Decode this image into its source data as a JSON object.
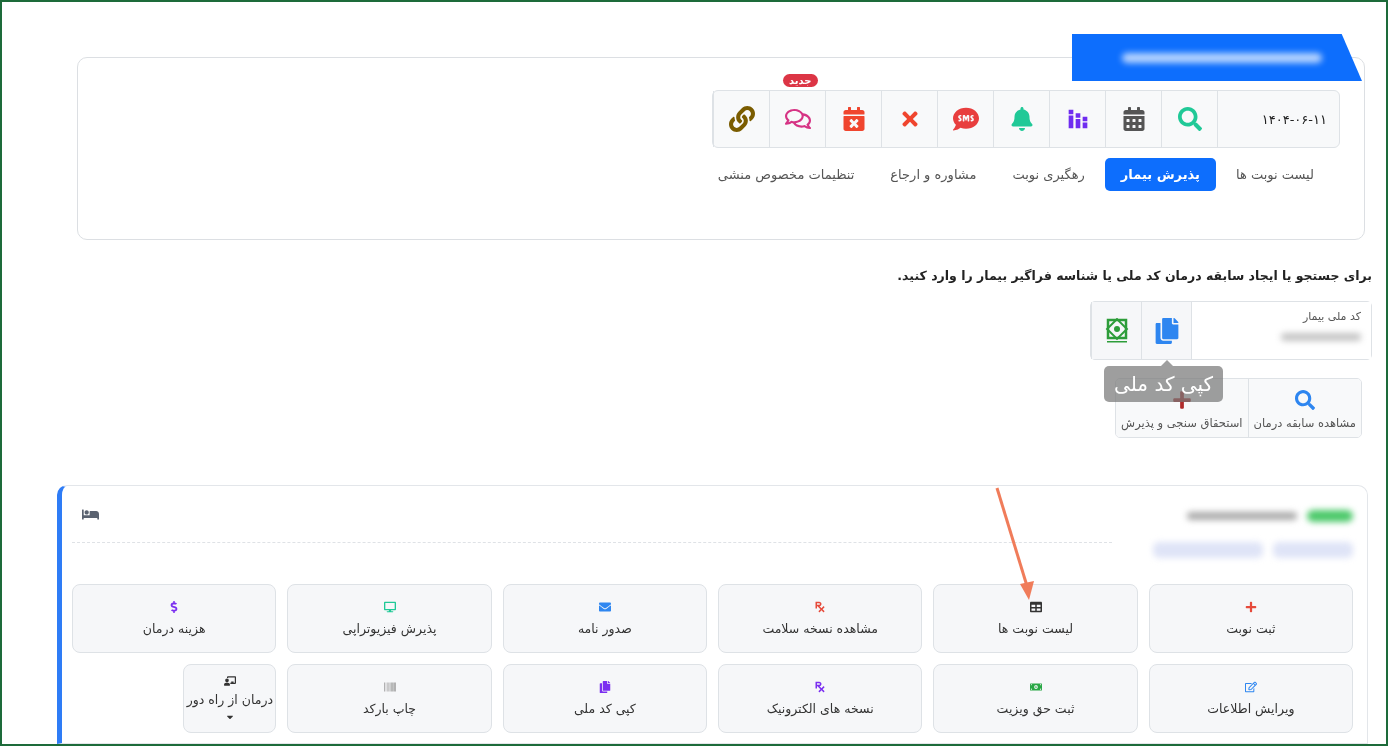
{
  "toolbar": {
    "date": "۱۴۰۴-۰۶-۱۱",
    "badge": "جدید",
    "buttons": [
      {
        "kind": "search"
      },
      {
        "kind": "calendar"
      },
      {
        "kind": "chart"
      },
      {
        "kind": "bell"
      },
      {
        "kind": "sms"
      },
      {
        "kind": "cancel"
      },
      {
        "kind": "calendar-cancel"
      },
      {
        "kind": "chat"
      },
      {
        "kind": "link"
      }
    ]
  },
  "tabs": [
    {
      "label": "لیست نوبت ها",
      "selected": false
    },
    {
      "label": "پذیرش بیمار",
      "selected": true
    },
    {
      "label": "رهگیری نوبت",
      "selected": false
    },
    {
      "label": "مشاوره و ارجاع",
      "selected": false
    },
    {
      "label": "تنظیمات مخصوص منشی",
      "selected": false
    }
  ],
  "instruction": "برای جستجو یا ایجاد سابقه درمان کد ملی یا شناسه فراگیر بیمار را وارد کنید.",
  "patient_field": {
    "label": "کد ملی بیمار"
  },
  "tooltip": "کپی کد ملی",
  "actions": [
    {
      "kind": "search",
      "label": "مشاهده سابقه درمان"
    },
    {
      "kind": "plus",
      "label": "استحقاق سنجی و پذیرش"
    }
  ],
  "services": [
    {
      "kind": "plus",
      "label": "ثبت نوبت"
    },
    {
      "kind": "table",
      "label": "لیست نوبت ها"
    },
    {
      "kind": "rx",
      "label": "مشاهده نسخه سلامت"
    },
    {
      "kind": "mail",
      "label": "صدور نامه"
    },
    {
      "kind": "monitor",
      "label": "پذیرش فیزیوتراپی"
    },
    {
      "kind": "dollar",
      "label": "هزینه درمان"
    },
    {
      "kind": "edit",
      "label": "ویرایش اطلاعات"
    },
    {
      "kind": "money",
      "label": "ثبت حق ویزیت"
    },
    {
      "kind": "rx2",
      "label": "نسخه های الکترونیک"
    },
    {
      "kind": "copy",
      "label": "کپی کد ملی"
    },
    {
      "kind": "barcode",
      "label": "چاپ بارکد"
    },
    {
      "kind": "teacher",
      "label": "درمان از راه دور",
      "dropdown": true
    }
  ]
}
